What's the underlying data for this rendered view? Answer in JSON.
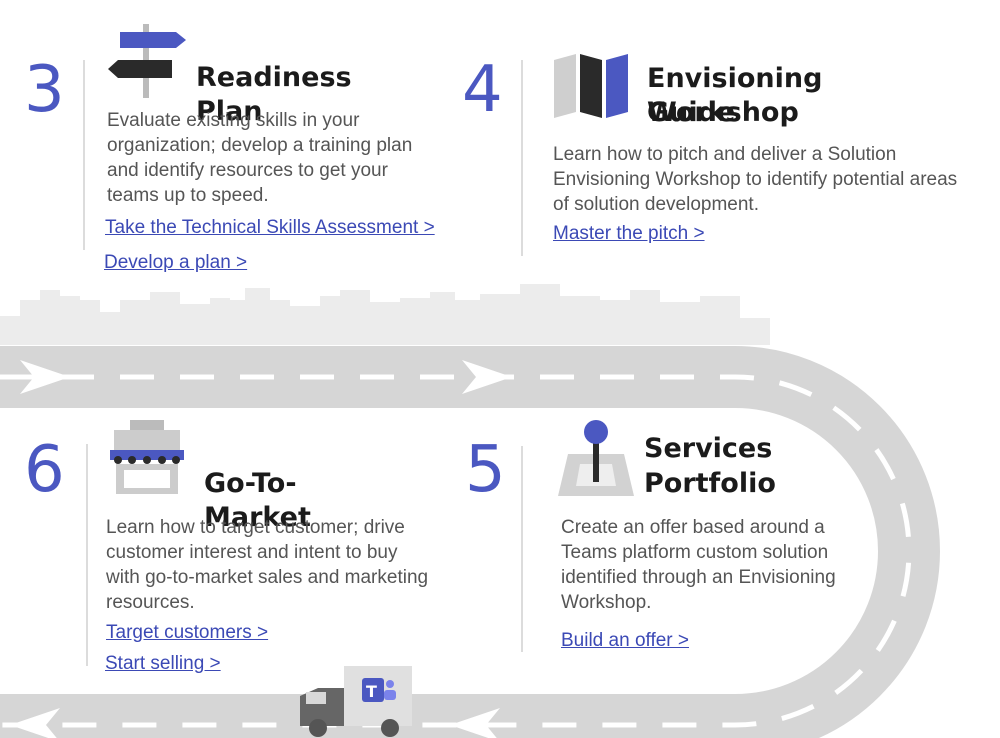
{
  "steps": [
    {
      "number": "3",
      "title": "Readiness Plan",
      "description": "Evaluate existing skills in your organization; develop a training plan and identify resources to get your teams up to speed.",
      "links": [
        "Take the Technical Skills Assessment >",
        "Develop a plan >"
      ],
      "icon": "signpost-icon"
    },
    {
      "number": "4",
      "title_line1": "Envisioning Workshop",
      "title_line2": "Guide",
      "description": "Learn how to pitch and deliver a Solution Envisioning Workshop to identify potential areas of solution development.",
      "links": [
        "Master the pitch >"
      ],
      "icon": "map-icon"
    },
    {
      "number": "5",
      "title_line1": "Services",
      "title_line2": "Portfolio",
      "description": "Create an offer based around a Teams platform custom solution identified through an Envisioning Workshop.",
      "links": [
        "Build an offer >"
      ],
      "icon": "map-pin-icon"
    },
    {
      "number": "6",
      "title": "Go-To-Market",
      "description": "Learn how to target customer; drive customer interest and intent to buy with go-to-market sales and marketing resources.",
      "links": [
        "Target customers >",
        "Start selling >"
      ],
      "icon": "storefront-icon"
    }
  ],
  "colors": {
    "accent": "#4b58c1",
    "road": "#d4d4d4",
    "skyline": "#ebebeb",
    "text": "#555555"
  }
}
